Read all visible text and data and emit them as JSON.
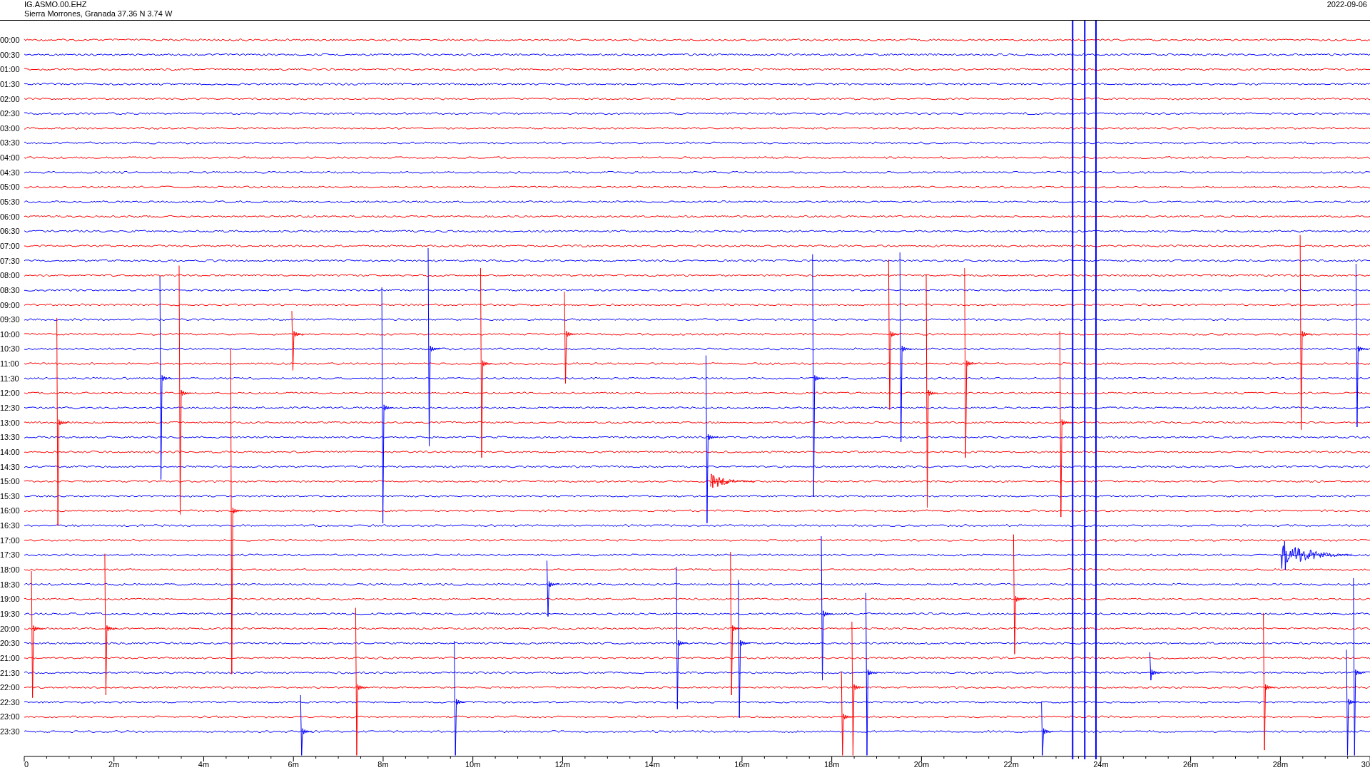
{
  "header": {
    "station": "IG.ASMO.00.EHZ",
    "location": "Sierra Morrones, Granada  37.36 N 3.74 W",
    "date": "2022-09-06"
  },
  "rows": [
    {
      "time": "00:00",
      "color": "#ff0000"
    },
    {
      "time": "00:30",
      "color": "#0000ff"
    },
    {
      "time": "01:00",
      "color": "#ff0000"
    },
    {
      "time": "01:30",
      "color": "#0000ff"
    },
    {
      "time": "02:00",
      "color": "#ff0000"
    },
    {
      "time": "02:30",
      "color": "#0000ff"
    },
    {
      "time": "03:00",
      "color": "#ff0000"
    },
    {
      "time": "03:30",
      "color": "#0000ff"
    },
    {
      "time": "04:00",
      "color": "#ff0000"
    },
    {
      "time": "04:30",
      "color": "#0000ff"
    },
    {
      "time": "05:00",
      "color": "#ff0000"
    },
    {
      "time": "05:30",
      "color": "#0000ff"
    },
    {
      "time": "06:00",
      "color": "#ff0000"
    },
    {
      "time": "06:30",
      "color": "#0000ff"
    },
    {
      "time": "07:00",
      "color": "#ff0000"
    },
    {
      "time": "07:30",
      "color": "#0000ff"
    },
    {
      "time": "08:00",
      "color": "#ff0000"
    },
    {
      "time": "08:30",
      "color": "#0000ff"
    },
    {
      "time": "09:00",
      "color": "#ff0000"
    },
    {
      "time": "09:30",
      "color": "#0000ff"
    },
    {
      "time": "10:00",
      "color": "#ff0000"
    },
    {
      "time": "10:30",
      "color": "#0000ff"
    },
    {
      "time": "11:00",
      "color": "#ff0000"
    },
    {
      "time": "11:30",
      "color": "#0000ff"
    },
    {
      "time": "12:00",
      "color": "#ff0000"
    },
    {
      "time": "12:30",
      "color": "#0000ff"
    },
    {
      "time": "13:00",
      "color": "#ff0000"
    },
    {
      "time": "13:30",
      "color": "#0000ff"
    },
    {
      "time": "14:00",
      "color": "#ff0000"
    },
    {
      "time": "14:30",
      "color": "#0000ff"
    },
    {
      "time": "15:00",
      "color": "#ff0000"
    },
    {
      "time": "15:30",
      "color": "#0000ff"
    },
    {
      "time": "16:00",
      "color": "#ff0000"
    },
    {
      "time": "16:30",
      "color": "#0000ff"
    },
    {
      "time": "17:00",
      "color": "#ff0000"
    },
    {
      "time": "17:30",
      "color": "#0000ff"
    },
    {
      "time": "18:00",
      "color": "#ff0000"
    },
    {
      "time": "18:30",
      "color": "#0000ff"
    },
    {
      "time": "19:00",
      "color": "#ff0000"
    },
    {
      "time": "19:30",
      "color": "#0000ff"
    },
    {
      "time": "20:00",
      "color": "#ff0000"
    },
    {
      "time": "20:30",
      "color": "#0000ff"
    },
    {
      "time": "21:00",
      "color": "#ff0000"
    },
    {
      "time": "21:30",
      "color": "#0000ff"
    },
    {
      "time": "22:00",
      "color": "#ff0000"
    },
    {
      "time": "22:30",
      "color": "#0000ff"
    },
    {
      "time": "23:00",
      "color": "#ff0000"
    },
    {
      "time": "23:30",
      "color": "#0000ff"
    }
  ],
  "x_axis": {
    "labels": [
      "0",
      "2m",
      "4m",
      "6m",
      "8m",
      "10m",
      "12m",
      "14m",
      "16m",
      "18m",
      "20m",
      "22m",
      "24m",
      "26m",
      "28m",
      "30"
    ]
  }
}
